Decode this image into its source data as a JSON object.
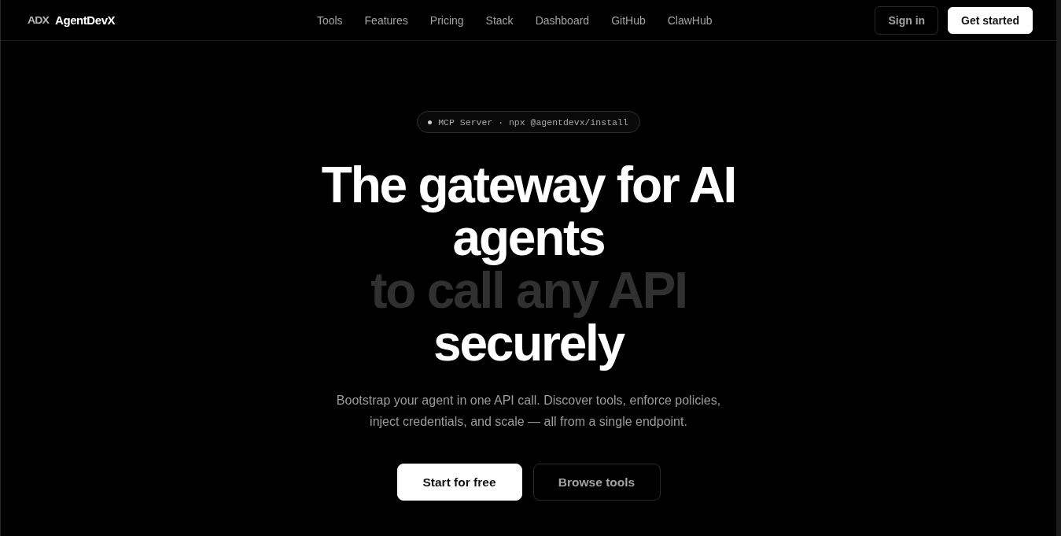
{
  "nav": {
    "logo_mark": "ADX",
    "brand": "AgentDevX",
    "links": [
      "Tools",
      "Features",
      "Pricing",
      "Stack",
      "Dashboard",
      "GitHub",
      "ClawHub"
    ],
    "actions": [
      {
        "label": "Sign in",
        "kind": "secondary"
      },
      {
        "label": "Get started",
        "kind": "primary"
      }
    ]
  },
  "hero": {
    "badge": "MCP Server · npx @agentdevx/install",
    "heading": [
      {
        "text": "The gateway for AI agents",
        "muted": false
      },
      {
        "text": "to call any API",
        "muted": true
      },
      {
        "text": "securely",
        "muted": false
      }
    ],
    "subtitle": "Bootstrap your agent in one API call. Discover tools, enforce policies, inject credentials, and scale — all from a single endpoint.",
    "buttons": [
      {
        "label": "Start for free",
        "kind": "primary"
      },
      {
        "label": "Browse tools",
        "kind": "secondary"
      }
    ]
  }
}
